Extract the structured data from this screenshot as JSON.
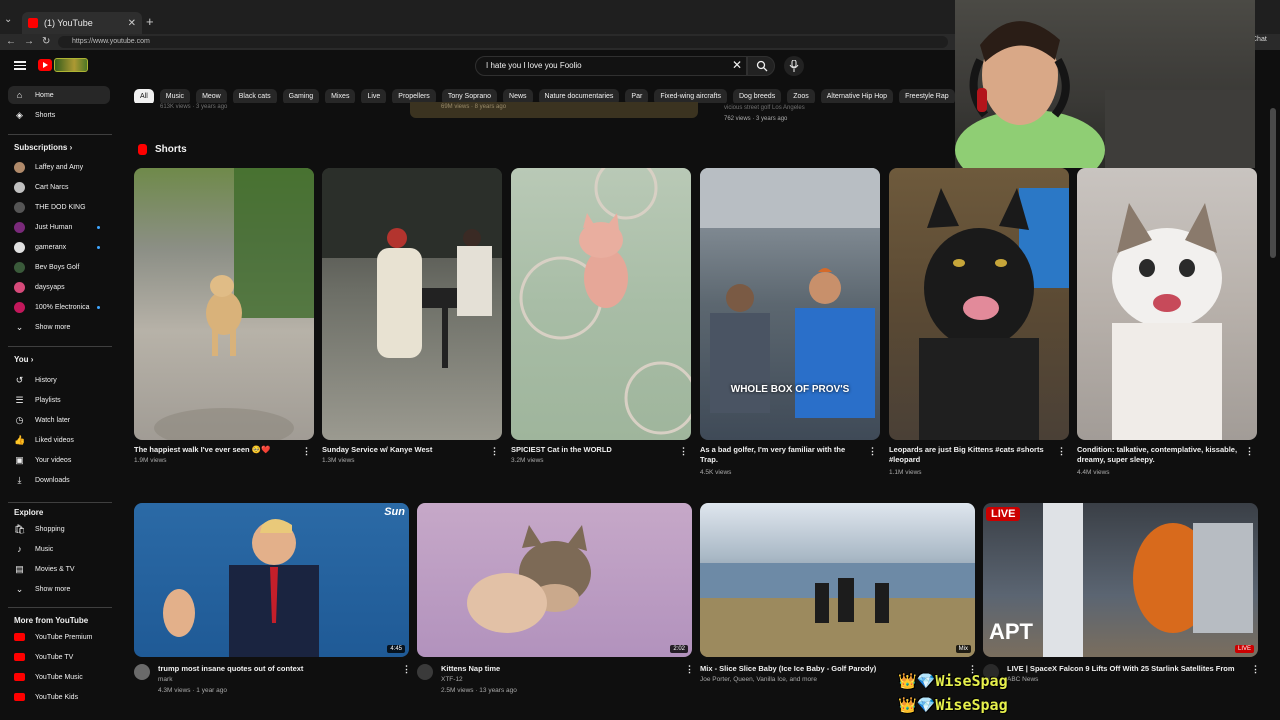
{
  "browser": {
    "tab_title": "(1) YouTube",
    "url": "https://www.youtube.com",
    "chat_label": "Chat"
  },
  "header": {
    "search_query": "I hate you I love you Foolio"
  },
  "chips": [
    "All",
    "Music",
    "Meow",
    "Black cats",
    "Gaming",
    "Mixes",
    "Live",
    "Propellers",
    "Tony Soprano",
    "News",
    "Nature documentaries",
    "Par",
    "Fixed-wing aircrafts",
    "Dog breeds",
    "Zoos",
    "Alternative Hip Hop",
    "Freestyle Rap"
  ],
  "sidebar": {
    "main": [
      {
        "label": "Home",
        "icon": "home-icon"
      },
      {
        "label": "Shorts",
        "icon": "shorts-icon"
      }
    ],
    "subscriptions_label": "Subscriptions",
    "subscriptions": [
      {
        "label": "Laffey and Amy",
        "color": "#b08a6a",
        "dot": false
      },
      {
        "label": "Cart Narcs",
        "color": "#c0c0c0",
        "dot": false
      },
      {
        "label": "THE DOD KING",
        "color": "#555555",
        "dot": false
      },
      {
        "label": "Just Human",
        "color": "#7a2a7a",
        "dot": true
      },
      {
        "label": "gameranx",
        "color": "#e0e0e0",
        "dot": true
      },
      {
        "label": "Bev Boys Golf",
        "color": "#3a5a3a",
        "dot": false
      },
      {
        "label": "daysyaps",
        "color": "#d64a7a",
        "dot": false
      },
      {
        "label": "100% Electronica",
        "color": "#c2185b",
        "dot": true
      }
    ],
    "show_more": "Show more",
    "you_label": "You",
    "you_items": [
      {
        "label": "History",
        "icon": "history-icon"
      },
      {
        "label": "Playlists",
        "icon": "playlists-icon"
      },
      {
        "label": "Watch later",
        "icon": "watch-later-icon"
      },
      {
        "label": "Liked videos",
        "icon": "liked-icon"
      },
      {
        "label": "Your videos",
        "icon": "your-videos-icon"
      },
      {
        "label": "Downloads",
        "icon": "downloads-icon"
      }
    ],
    "explore_label": "Explore",
    "explore_items": [
      {
        "label": "Shopping",
        "icon": "shopping-icon"
      },
      {
        "label": "Music",
        "icon": "music-icon"
      },
      {
        "label": "Movies & TV",
        "icon": "movies-icon"
      }
    ],
    "explore_show_more": "Show more",
    "more_label": "More from YouTube",
    "more_items": [
      {
        "label": "YouTube Premium"
      },
      {
        "label": "YouTube TV"
      },
      {
        "label": "YouTube Music"
      },
      {
        "label": "YouTube Kids"
      }
    ]
  },
  "previous_row": {
    "meta1": "613K views · 3 years ago",
    "meta2": "69M views · 8 years ago",
    "meta3a": "vicious street golf Los Angeles",
    "meta3b": "762 views · 3 years ago"
  },
  "shorts": {
    "heading": "Shorts",
    "items": [
      {
        "title": "The happiest walk I've ever seen 🥺❤️",
        "views": "1.9M views"
      },
      {
        "title": "Sunday Service w/ Kanye West",
        "views": "1.3M views"
      },
      {
        "title": "SPICIEST Cat in the WORLD",
        "views": "3.2M views"
      },
      {
        "title": "As a bad golfer, I'm very familiar with the Trap.",
        "views": "4.5K views",
        "caption": "WHOLE BOX OF PROV'S"
      },
      {
        "title": "Leopards are just Big Kittens #cats #shorts #leopard",
        "views": "1.1M views"
      },
      {
        "title": "Condition: talkative, contemplative, kissable, dreamy, super sleepy.",
        "views": "4.4M views"
      }
    ]
  },
  "videos": [
    {
      "title": "trump most insane quotes out of context",
      "channel": "mark",
      "meta": "4.3M views · 1 year ago",
      "duration": "4:45",
      "badge": "Sun"
    },
    {
      "title": "Kittens Nap time",
      "channel": "XTF-12",
      "meta": "2.5M views · 13 years ago",
      "duration": "2:02"
    },
    {
      "title": "Mix - Slice Slice Baby (Ice Ice Baby - Golf Parody)",
      "channel": "Joe Porter, Queen, Vanilla Ice, and more",
      "meta": "",
      "duration": "Mix"
    },
    {
      "title": "LIVE | SpaceX Falcon 9 Lifts Off With 25 Starlink Satellites From",
      "channel": "ABC News",
      "meta": "",
      "duration": "LIVE",
      "badge": "LIVE",
      "logo": "APT"
    }
  ],
  "watermark": "WiseSpag"
}
